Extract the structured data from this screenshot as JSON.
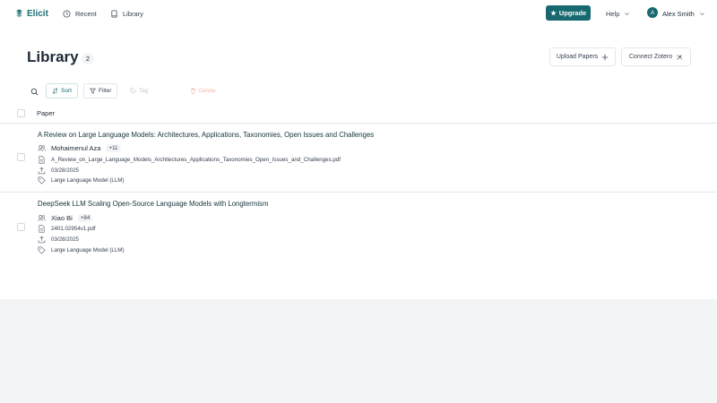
{
  "nav": {
    "brand": "Elicit",
    "recent": "Recent",
    "library": "Library",
    "upgrade": "Upgrade",
    "help": "Help",
    "avatar_initial": "A",
    "user_name": "Alex Smith"
  },
  "header": {
    "title": "Library",
    "count": "2",
    "upload_label": "Upload Papers",
    "zotero_label": "Connect Zotero"
  },
  "toolbar": {
    "sort": "Sort",
    "filter": "Filter",
    "tag": "Tag",
    "delete": "Delete"
  },
  "table": {
    "column_paper": "Paper",
    "rows": [
      {
        "title": "A Review on Large Language Models: Architectures, Applications, Taxonomies, Open Issues and Challenges",
        "author": "Mohaimenul Aza",
        "more_authors": "+11",
        "file": "A_Review_on_Large_Language_Models_Architectures_Applications_Taxonomies_Open_Issues_and_Challenges.pdf",
        "date": "03/28/2025",
        "tag": "Large Language Model (LLM)"
      },
      {
        "title": "DeepSeek LLM Scaling Open-Source Language Models with Longtermism",
        "author": "Xiao Bi",
        "more_authors": "+84",
        "file": "2401.02954v1.pdf",
        "date": "03/28/2025",
        "tag": "Large Language Model (LLM)"
      }
    ]
  },
  "colors": {
    "accent": "#17696f",
    "delete": "#f3b8a8",
    "disabled": "#c2c8d0"
  }
}
